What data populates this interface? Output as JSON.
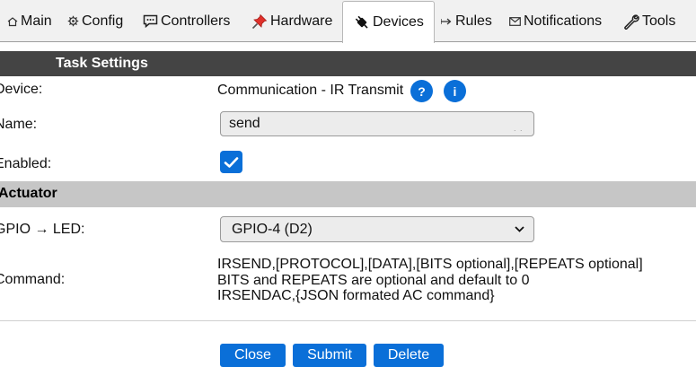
{
  "tabs": [
    {
      "label": "Main",
      "icon": "home-icon"
    },
    {
      "label": "Config",
      "icon": "gear-icon"
    },
    {
      "label": "Controllers",
      "icon": "speech-bubble-icon"
    },
    {
      "label": "Hardware",
      "icon": "pushpin-icon"
    },
    {
      "label": "Devices",
      "icon": "plug-icon",
      "active": true
    },
    {
      "label": "Rules",
      "icon": "arrow-icon"
    },
    {
      "label": "Notifications",
      "icon": "envelope-icon"
    },
    {
      "label": "Tools",
      "icon": "wrench-icon"
    }
  ],
  "task_settings": {
    "header": "Task Settings",
    "device_label": "Device:",
    "device_value": "Communication - IR Transmit",
    "help_button": "?",
    "info_button": "i",
    "name_label": "Name:",
    "name_value": "send",
    "enabled_label": "Enabled:",
    "enabled_checked": true
  },
  "actuator": {
    "header": "Actuator",
    "gpio_label": "GPIO → LED:",
    "gpio_selected": "GPIO-4 (D2)",
    "command_label": "Command:",
    "command_lines": [
      "IRSEND,[PROTOCOL],[DATA],[BITS optional],[REPEATS optional]",
      "BITS and REPEATS are optional and default to 0",
      "IRSENDAC,{JSON formated AC command}"
    ]
  },
  "buttons": {
    "close": "Close",
    "submit": "Submit",
    "delete": "Delete"
  },
  "colors": {
    "accent": "#0a6fd8",
    "header_dark": "#444444",
    "header_gray": "#c6c6c6",
    "tabbar": "#f1f1f1"
  }
}
